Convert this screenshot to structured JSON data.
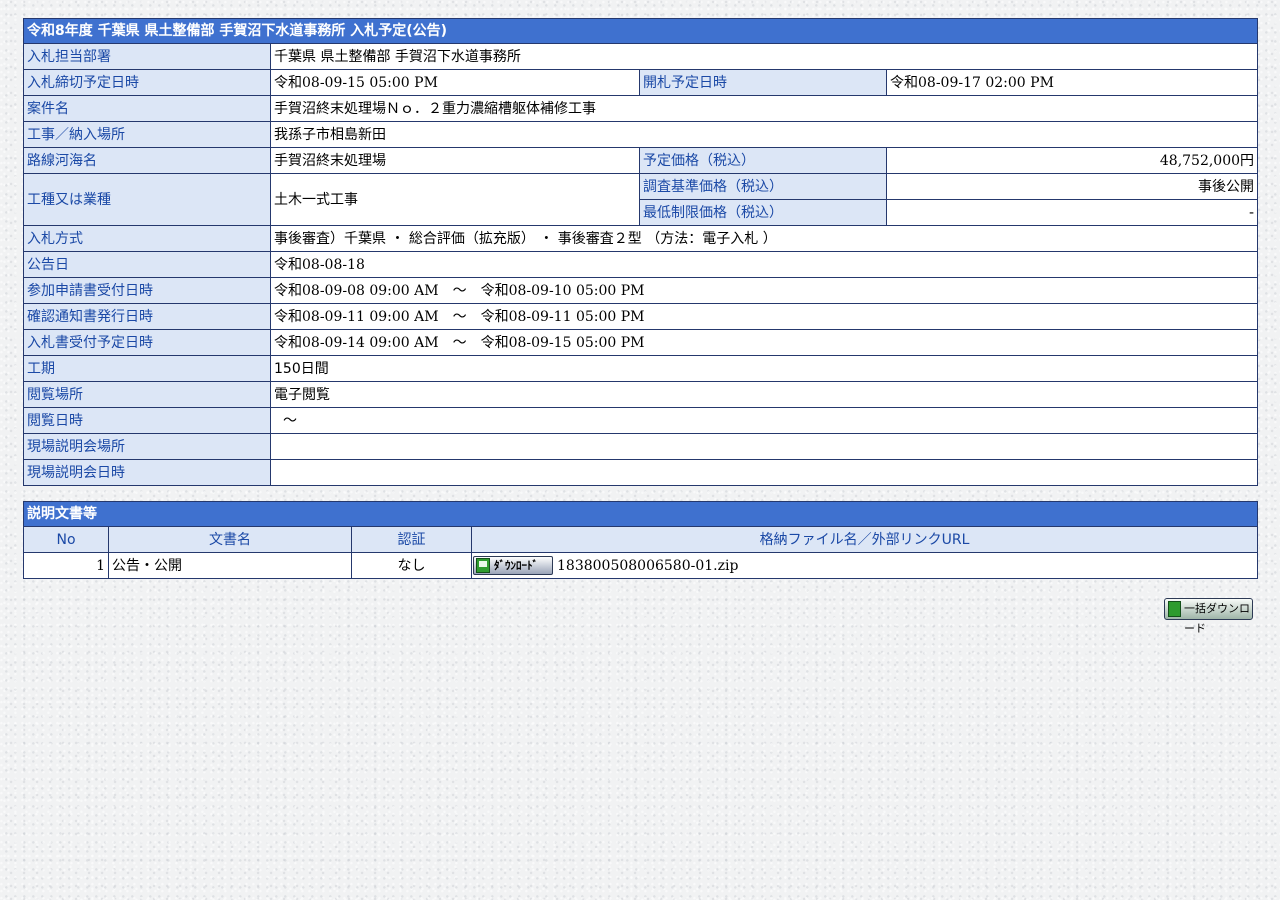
{
  "notice": {
    "title": "令和8年度 千葉県 県土整備部 手賀沼下水道事務所 入札予定(公告)",
    "rows": {
      "dept": {
        "label": "入札担当部署",
        "value": "千葉県 県土整備部 手賀沼下水道事務所"
      },
      "deadline": {
        "label": "入札締切予定日時",
        "value": "令和08-09-15 05:00 PM"
      },
      "opening": {
        "label": "開札予定日時",
        "value": "令和08-09-17 02:00 PM"
      },
      "case_name": {
        "label": "案件名",
        "value": "手賀沼終末処理場Ｎｏ．２重力濃縮槽躯体補修工事"
      },
      "location": {
        "label": "工事／納入場所",
        "value": "我孫子市相島新田"
      },
      "route": {
        "label": "路線河海名",
        "value": "手賀沼終末処理場"
      },
      "planned_price": {
        "label": "予定価格（税込）",
        "value": "48,752,000円"
      },
      "work_type": {
        "label": "工種又は業種",
        "value": "土木一式工事"
      },
      "survey_price": {
        "label": "調査基準価格（税込）",
        "value": "事後公開"
      },
      "min_price": {
        "label": "最低制限価格（税込）",
        "value": "-"
      },
      "method": {
        "label": "入札方式",
        "value": "事後審査）千葉県 ・ 総合評価（拡充版） ・ 事後審査２型 （方法：電子入札 ）"
      },
      "announce_date": {
        "label": "公告日",
        "value": "令和08-08-18"
      },
      "application": {
        "label": "参加申請書受付日時",
        "value": "令和08-09-08 09:00 AM　～　令和08-09-10 05:00 PM"
      },
      "confirmation": {
        "label": "確認通知書発行日時",
        "value": "令和08-09-11 09:00 AM　～　令和08-09-11 05:00 PM"
      },
      "bid_receipt": {
        "label": "入札書受付予定日時",
        "value": "令和08-09-14 09:00 AM　～　令和08-09-15 05:00 PM"
      },
      "period": {
        "label": "工期",
        "value": "150日間"
      },
      "view_place": {
        "label": "閲覧場所",
        "value": "電子閲覧"
      },
      "view_datetime": {
        "label": "閲覧日時",
        "value": "～"
      },
      "site_place": {
        "label": "現場説明会場所",
        "value": ""
      },
      "site_datetime": {
        "label": "現場説明会日時",
        "value": ""
      }
    }
  },
  "documents": {
    "title": "説明文書等",
    "headers": {
      "no": "No",
      "name": "文書名",
      "auth": "認証",
      "file": "格納ファイル名／外部リンクURL"
    },
    "rows": [
      {
        "no": "1",
        "name": "公告・公開",
        "auth": "なし",
        "download_label": "ﾀﾞｳﾝﾛｰﾄﾞ",
        "file": "183800508006580-01.zip"
      }
    ]
  },
  "bulk_download": {
    "label": "一括ダウンロード"
  },
  "colors": {
    "title_bar": "#3f71cf",
    "label_cell": "#dce6f6",
    "label_text": "#1b49a6",
    "border": "#25386d"
  }
}
